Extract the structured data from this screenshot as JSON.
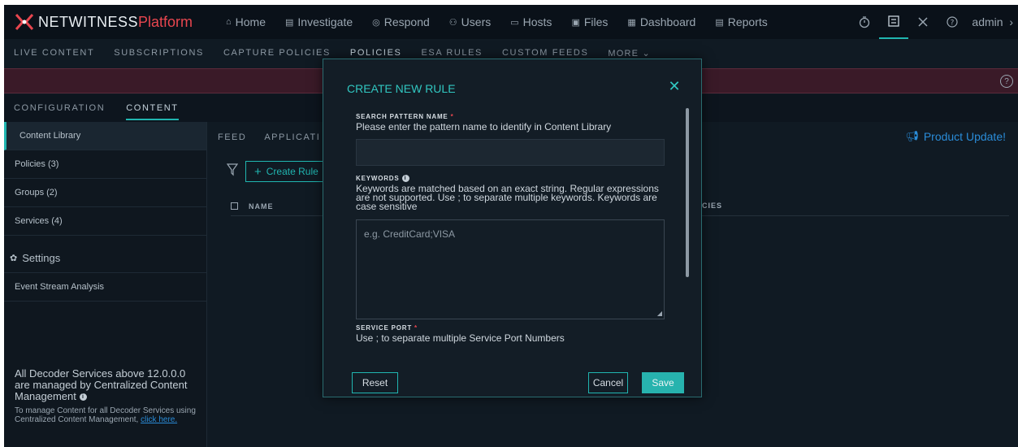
{
  "brand": {
    "name": "NETWITNESS",
    "accent": "Platform",
    "accent_color": "#e8464f"
  },
  "nav": {
    "items": [
      {
        "label": "Home",
        "icon": "home-icon"
      },
      {
        "label": "Investigate",
        "icon": "investigate-icon"
      },
      {
        "label": "Respond",
        "icon": "respond-icon"
      },
      {
        "label": "Users",
        "icon": "users-icon"
      },
      {
        "label": "Hosts",
        "icon": "hosts-icon"
      },
      {
        "label": "Files",
        "icon": "files-icon"
      },
      {
        "label": "Dashboard",
        "icon": "dashboard-icon"
      },
      {
        "label": "Reports",
        "icon": "reports-icon"
      }
    ],
    "user": "admin"
  },
  "subnav": {
    "items": [
      "LIVE CONTENT",
      "SUBSCRIPTIONS",
      "CAPTURE POLICIES",
      "POLICIES",
      "ESA RULES",
      "CUSTOM FEEDS"
    ],
    "more": "MORE"
  },
  "content_tabs": [
    "CONFIGURATION",
    "CONTENT"
  ],
  "sidebar": {
    "items": [
      "Content Library",
      "Policies (3)",
      "Groups (2)",
      "Services (4)"
    ],
    "section": "Settings",
    "section_items": [
      "Event Stream Analysis"
    ],
    "note_main": "All Decoder Services above 12.0.0.0 are managed by Centralized Content Management",
    "note_sub": "To manage Content for all Decoder Services using Centralized Content Management,",
    "note_link": "click here."
  },
  "main": {
    "tabs": [
      "FEED",
      "APPLICATI"
    ],
    "product_update": "Product Update!",
    "create_rule": "Create Rule",
    "columns": {
      "name": "NAME",
      "policies": "CIES"
    }
  },
  "modal": {
    "title": "CREATE NEW RULE",
    "fields": {
      "pattern_name": {
        "label": "SEARCH PATTERN NAME",
        "help": "Please enter the pattern name to identify in Content Library",
        "value": ""
      },
      "keywords": {
        "label": "KEYWORDS",
        "help": "Keywords are matched based on an exact string. Regular expressions are not supported. Use ; to separate multiple keywords. Keywords are case sensitive",
        "placeholder": "e.g. CreditCard;VISA"
      },
      "service_port": {
        "label": "SERVICE PORT",
        "help": "Use ; to separate multiple Service Port Numbers"
      }
    },
    "buttons": {
      "reset": "Reset",
      "cancel": "Cancel",
      "save": "Save"
    }
  },
  "colors": {
    "accent": "#20b5b0",
    "link": "#2a8cd8",
    "banner": "#3a1a28"
  }
}
